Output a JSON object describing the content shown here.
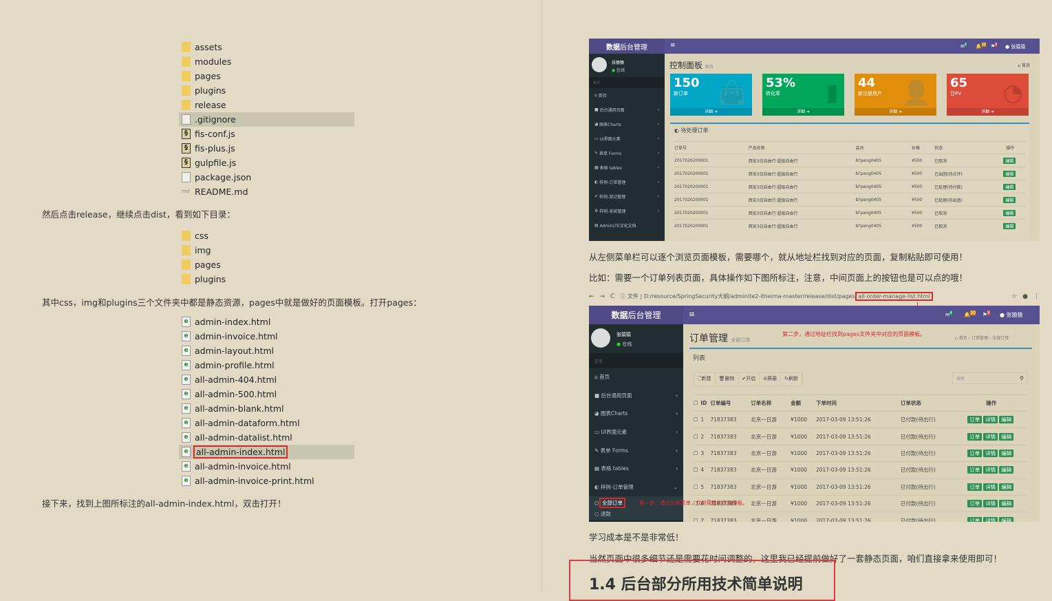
{
  "left": {
    "files1": [
      {
        "name": "assets",
        "type": "folder"
      },
      {
        "name": "modules",
        "type": "folder"
      },
      {
        "name": "pages",
        "type": "folder"
      },
      {
        "name": "plugins",
        "type": "folder"
      },
      {
        "name": "release",
        "type": "folder"
      },
      {
        "name": ".gitignore",
        "type": "doc",
        "selected": true
      },
      {
        "name": "fis-conf.js",
        "type": "js"
      },
      {
        "name": "fis-plus.js",
        "type": "js"
      },
      {
        "name": "gulpfile.js",
        "type": "js"
      },
      {
        "name": "package.json",
        "type": "doc"
      },
      {
        "name": "README.md",
        "type": "md"
      }
    ],
    "p1": "然后点击release，继续点击dist，看到如下目录：",
    "files2": [
      {
        "name": "css",
        "type": "folder"
      },
      {
        "name": "img",
        "type": "folder"
      },
      {
        "name": "pages",
        "type": "folder"
      },
      {
        "name": "plugins",
        "type": "folder"
      }
    ],
    "p2": "其中css，img和plugins三个文件夹中都是静态资源，pages中就是做好的页面模板。打开pages：",
    "files3": [
      {
        "name": "admin-index.html",
        "type": "html"
      },
      {
        "name": "admin-invoice.html",
        "type": "html"
      },
      {
        "name": "admin-layout.html",
        "type": "html"
      },
      {
        "name": "admin-profile.html",
        "type": "html"
      },
      {
        "name": "all-admin-404.html",
        "type": "html"
      },
      {
        "name": "all-admin-500.html",
        "type": "html"
      },
      {
        "name": "all-admin-blank.html",
        "type": "html"
      },
      {
        "name": "all-admin-dataform.html",
        "type": "html"
      },
      {
        "name": "all-admin-datalist.html",
        "type": "html"
      },
      {
        "name": "all-admin-index.html",
        "type": "html",
        "selected": true,
        "highlighted": true
      },
      {
        "name": "all-admin-invoice.html",
        "type": "html"
      },
      {
        "name": "all-admin-invoice-print.html",
        "type": "html"
      }
    ],
    "p3": "接下来，找到上图所标注的all-admin-index.html，双击打开！"
  },
  "shot1": {
    "brand_bold": "数据",
    "brand_rest": "后台管理",
    "menu_icon": "≡",
    "badges": [
      "4",
      "10",
      "9"
    ],
    "user": "张猿猿",
    "status": "在线",
    "nav_header": "菜单",
    "menu": [
      "首页",
      "后台通用页面",
      "图表Charts",
      "UI界面元素",
      "表单 Forms",
      "表格 tables",
      "样例-订单管理",
      "样例-游记管理",
      "样例-系统管理",
      "AdminLTE汉化文档"
    ],
    "title": "控制面板",
    "subtitle": "首页",
    "breadcrumb": "首页",
    "stats": [
      {
        "num": "150",
        "label": "新订单",
        "color": "#00a7c6",
        "icon": "bag-icon"
      },
      {
        "num": "53%",
        "label": "转化率",
        "color": "#00a65a",
        "icon": "bar-chart-icon"
      },
      {
        "num": "44",
        "label": "新注册用户",
        "color": "#e08e0b",
        "icon": "user-add-icon"
      },
      {
        "num": "65",
        "label": "日PV",
        "color": "#dd4b39",
        "icon": "pie-chart-icon"
      }
    ],
    "more": "详细",
    "box_title": "待处理订单",
    "columns": [
      "订单号",
      "产品名称",
      "会员",
      "价格",
      "状态",
      "操作"
    ],
    "rows": [
      [
        "2017020200001",
        "西安3日自由行·超级自由行",
        "bl'peng0405",
        "¥500",
        "已取消"
      ],
      [
        "2017020200001",
        "西安3日自由行·超级自由行",
        "bl'peng0405",
        "¥500",
        "已出团(待点评)"
      ],
      [
        "2017020200001",
        "西安3日自由行·超级自由行",
        "bl'peng0405",
        "¥500",
        "已处理(待付款)"
      ],
      [
        "2017020200001",
        "西安3日自由行·超级自由行",
        "bl'peng0405",
        "¥500",
        "已处理(待出团)"
      ],
      [
        "2017020200001",
        "西安3日自由行·超级自由行",
        "bl'peng0405",
        "¥500",
        "已取消"
      ],
      [
        "2017020200001",
        "西安3日自由行·超级自由行",
        "bl'peng0405",
        "¥500",
        "已取消"
      ]
    ],
    "edit": "编辑"
  },
  "p4": "从左侧菜单栏可以逐个浏览页面模板，需要哪个，就从地址栏找到对应的页面，复制粘贴即可使用！",
  "p5": "比如：需要一个订单列表页面，具体操作如下图所标注，注意，中间页面上的按钮也是可以点的哦！",
  "browser": {
    "file_label": "文件",
    "url_prefix": "D:/resource/SpringSecurity大纲/adminlte2-itheima-master/release/dist/pages/",
    "url_page": "all-order-manage-list.html"
  },
  "shot2": {
    "brand_bold": "数据",
    "brand_rest": "后台管理",
    "menu_icon": "≡",
    "badges": [
      "4",
      "10",
      "9"
    ],
    "user": "张猿猿",
    "status": "在线",
    "nav_header": "菜单",
    "menu": [
      "首页",
      "后台通用页面",
      "图表Charts",
      "UI界面元素",
      "表单 Forms",
      "表格 tables",
      "样例-订单管理"
    ],
    "submenu": [
      "全部订单",
      "退款"
    ],
    "title": "订单管理",
    "subtitle": "全部订单",
    "step2": "第二步，通过地址栏找到pages文件夹中对应的页面模板。",
    "step1": "第一步，通过左侧菜单，找到需要的页面模板。",
    "breadcrumb": [
      "首页",
      "订单管理",
      "全部订单"
    ],
    "box_title": "列表",
    "tools": [
      "新建",
      "删除",
      "开启",
      "屏蔽",
      "刷新"
    ],
    "search_placeholder": "搜索",
    "columns": [
      "ID",
      "订单编号",
      "订单名称",
      "金额",
      "下单时间",
      "订单状态",
      "操作"
    ],
    "rows": [
      [
        "1",
        "71837383",
        "北京一日游",
        "¥1000",
        "2017-03-09 13:51:26",
        "已付款(待出行)"
      ],
      [
        "2",
        "71837383",
        "北京一日游",
        "¥1000",
        "2017-03-09 13:51:26",
        "已付款(待出行)"
      ],
      [
        "3",
        "71837383",
        "北京一日游",
        "¥1000",
        "2017-03-09 13:51:26",
        "已付款(待出行)"
      ],
      [
        "4",
        "71837383",
        "北京一日游",
        "¥1000",
        "2017-03-09 13:51:26",
        "已付款(待出行)"
      ],
      [
        "5",
        "71837383",
        "北京一日游",
        "¥1000",
        "2017-03-09 13:51:26",
        "已付款(待出行)"
      ],
      [
        "6",
        "71837383",
        "北京一日游",
        "¥1000",
        "2017-03-09 13:51:26",
        "已付款(待出行)"
      ],
      [
        "7",
        "71837383",
        "北京一日游",
        "¥1000",
        "2017-03-09 13:51:26",
        "已付款(待出行)"
      ]
    ],
    "actions": [
      "订单",
      "详情",
      "编辑"
    ]
  },
  "p6": "学习成本是不是非常低！",
  "p7": "当然页面中很多细节还是需要花时间调整的，这里我已经提前做好了一套静态页面，咱们直接拿来使用即可！",
  "heading": "1.4 后台部分所用技术简单说明"
}
